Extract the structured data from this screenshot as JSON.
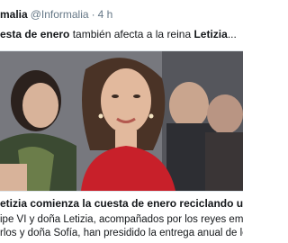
{
  "tweet": {
    "author_name": "malia",
    "author_handle": "@Informalia",
    "separator": "·",
    "time": "4 h",
    "text_parts": {
      "bold_1": "esta de enero",
      "plain_1": " también afecta a la reina ",
      "bold_2": "Letizia",
      "plain_2": "..."
    }
  },
  "card": {
    "title": "etizia comienza la cuesta de enero reciclando un vestido rojo",
    "desc_line_1": "ipe VI y doña Letizia, acompañados por los reyes eméritos, don",
    "desc_line_2": "rlos y doña Sofía, han presidido la entrega anual de los Premios"
  },
  "colors": {
    "dress_red": "#c8202a",
    "text_dark": "#14171a",
    "text_muted": "#657786",
    "border": "#e1e8ed"
  }
}
